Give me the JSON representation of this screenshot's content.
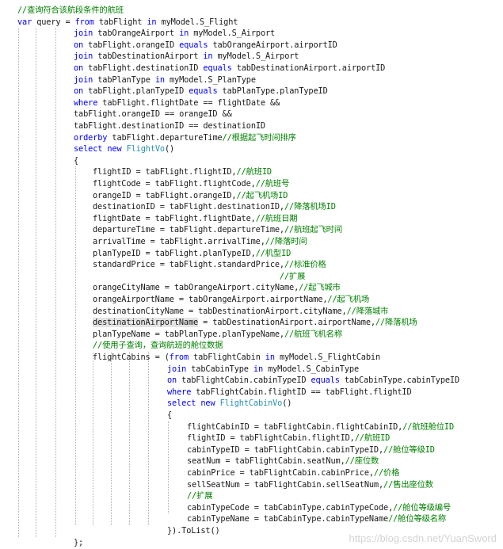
{
  "code_lines": [
    [
      {
        "t": "//查询符合该航段条件的航班",
        "c": "cm"
      }
    ],
    [
      {
        "t": "var",
        "c": "kw"
      },
      {
        "t": " query = "
      },
      {
        "t": "from",
        "c": "kw"
      },
      {
        "t": " tabFlight "
      },
      {
        "t": "in",
        "c": "kw"
      },
      {
        "t": " myModel.S_Flight"
      }
    ],
    [
      {
        "t": "join",
        "c": "kw"
      },
      {
        "t": " tabOrangeAirport "
      },
      {
        "t": "in",
        "c": "kw"
      },
      {
        "t": " myModel.S_Airport"
      }
    ],
    [
      {
        "t": "on",
        "c": "kw"
      },
      {
        "t": " tabFlight.orangeID "
      },
      {
        "t": "equals",
        "c": "kw"
      },
      {
        "t": " tabOrangeAirport.airportID"
      }
    ],
    [
      {
        "t": "join",
        "c": "kw"
      },
      {
        "t": " tabDestinationAirport "
      },
      {
        "t": "in",
        "c": "kw"
      },
      {
        "t": " myModel.S_Airport"
      }
    ],
    [
      {
        "t": "on",
        "c": "kw"
      },
      {
        "t": " tabFlight.destinationID "
      },
      {
        "t": "equals",
        "c": "kw"
      },
      {
        "t": " tabDestinationAirport.airportID"
      }
    ],
    [
      {
        "t": "join",
        "c": "kw"
      },
      {
        "t": " tabPlanType "
      },
      {
        "t": "in",
        "c": "kw"
      },
      {
        "t": " myModel.S_PlanType"
      }
    ],
    [
      {
        "t": "on",
        "c": "kw"
      },
      {
        "t": " tabFlight.planTypeID "
      },
      {
        "t": "equals",
        "c": "kw"
      },
      {
        "t": " tabPlanType.planTypeID"
      }
    ],
    [
      {
        "t": "where",
        "c": "kw"
      },
      {
        "t": " tabFlight.flightDate == flightDate &&"
      }
    ],
    [
      {
        "t": "tabFlight.orangeID == orangeID &&"
      }
    ],
    [
      {
        "t": "tabFlight.destinationID == destinationID"
      }
    ],
    [
      {
        "t": "orderby",
        "c": "kw"
      },
      {
        "t": " tabFlight.departureTime"
      },
      {
        "t": "//根据起飞时间排序",
        "c": "cm"
      }
    ],
    [
      {
        "t": "select",
        "c": "kw"
      },
      {
        "t": " "
      },
      {
        "t": "new",
        "c": "kw"
      },
      {
        "t": " "
      },
      {
        "t": "FlightVo",
        "c": "ty"
      },
      {
        "t": "()"
      }
    ],
    [
      {
        "t": "{"
      }
    ],
    [
      {
        "t": "flightID = tabFlight.flightID,"
      },
      {
        "t": "//航班ID",
        "c": "cm"
      }
    ],
    [
      {
        "t": "flightCode = tabFlight.flightCode,"
      },
      {
        "t": "//航班号",
        "c": "cm"
      }
    ],
    [
      {
        "t": "orangeID = tabFlight.orangeID,"
      },
      {
        "t": "//起飞机场ID",
        "c": "cm"
      }
    ],
    [
      {
        "t": "destinationID = tabFlight.destinationID,"
      },
      {
        "t": "//降落机场ID",
        "c": "cm"
      }
    ],
    [
      {
        "t": "flightDate = tabFlight.flightDate,"
      },
      {
        "t": "//航班日期",
        "c": "cm"
      }
    ],
    [
      {
        "t": "departureTime = tabFlight.departureTime,"
      },
      {
        "t": "//航班起飞时间",
        "c": "cm"
      }
    ],
    [
      {
        "t": "arrivalTime = tabFlight.arrivalTime,"
      },
      {
        "t": "//降落时间",
        "c": "cm"
      }
    ],
    [
      {
        "t": "planTypeID = tabFlight.planTypeID,"
      },
      {
        "t": "//机型ID",
        "c": "cm"
      }
    ],
    [
      {
        "t": "standardPrice = tabFlight.standardPrice,"
      },
      {
        "t": "//标准价格",
        "c": "cm"
      }
    ],
    [
      {
        "t": "                                       "
      },
      {
        "t": "//扩展",
        "c": "cm"
      }
    ],
    [
      {
        "t": "orangeCityName = tabOrangeAirport.cityName,"
      },
      {
        "t": "//起飞城市",
        "c": "cm"
      }
    ],
    [
      {
        "t": "orangeAirportName = tabOrangeAirport.airportName,"
      },
      {
        "t": "//起飞机场",
        "c": "cm"
      }
    ],
    [
      {
        "t": "destinationCityName = tabDestinationAirport.cityName,"
      },
      {
        "t": "//降落城市",
        "c": "cm"
      }
    ],
    [
      {
        "t": "destinationAirportName",
        "c": "hl"
      },
      {
        "t": " = tabDestinationAirport.airportName,"
      },
      {
        "t": "//降落机场",
        "c": "cm"
      }
    ],
    [
      {
        "t": "planTypeName = tabPlanType.planTypeName,"
      },
      {
        "t": "//航班飞机名称",
        "c": "cm"
      }
    ],
    [
      {
        "t": "//使用子查询，查询航班的舱位数据",
        "c": "cm"
      }
    ],
    [
      {
        "t": "flightCabins = ("
      },
      {
        "t": "from",
        "c": "kw"
      },
      {
        "t": " tabFlightCabin "
      },
      {
        "t": "in",
        "c": "kw"
      },
      {
        "t": " myModel.S_FlightCabin"
      }
    ],
    [
      {
        "t": "join",
        "c": "kw"
      },
      {
        "t": " tabCabinType "
      },
      {
        "t": "in",
        "c": "kw"
      },
      {
        "t": " myModel.S_CabinType"
      }
    ],
    [
      {
        "t": "on",
        "c": "kw"
      },
      {
        "t": " tabFlightCabin.cabinTypeID "
      },
      {
        "t": "equals",
        "c": "kw"
      },
      {
        "t": " tabCabinType.cabinTypeID"
      }
    ],
    [
      {
        "t": "where",
        "c": "kw"
      },
      {
        "t": " tabFlightCabin.flightID == tabFlight.flightID"
      }
    ],
    [
      {
        "t": "select",
        "c": "kw"
      },
      {
        "t": " "
      },
      {
        "t": "new",
        "c": "kw"
      },
      {
        "t": " "
      },
      {
        "t": "FlightCabinVo",
        "c": "ty"
      },
      {
        "t": "()"
      }
    ],
    [
      {
        "t": "{"
      }
    ],
    [
      {
        "t": "flightCabinID = tabFlightCabin.flightCabinID,"
      },
      {
        "t": "//航班舱位ID",
        "c": "cm"
      }
    ],
    [
      {
        "t": "flightID = tabFlightCabin.flightID,"
      },
      {
        "t": "//航班ID",
        "c": "cm"
      }
    ],
    [
      {
        "t": "cabinTypeID = tabFlightCabin.cabinTypeID,"
      },
      {
        "t": "//舱位等级ID",
        "c": "cm"
      }
    ],
    [
      {
        "t": "seatNum = tabFlightCabin.seatNum,"
      },
      {
        "t": "//座位数",
        "c": "cm"
      }
    ],
    [
      {
        "t": "cabinPrice = tabFlightCabin.cabinPrice,"
      },
      {
        "t": "//价格",
        "c": "cm"
      }
    ],
    [
      {
        "t": "sellSeatNum = tabFlightCabin.sellSeatNum,"
      },
      {
        "t": "//售出座位数",
        "c": "cm"
      }
    ],
    [
      {
        "t": "//扩展",
        "c": "cm"
      }
    ],
    [
      {
        "t": "cabinTypeCode = tabCabinType.cabinTypeCode,"
      },
      {
        "t": "//舱位等级编号",
        "c": "cm"
      }
    ],
    [
      {
        "t": "cabinTypeName = tabCabinType.cabinTypeName"
      },
      {
        "t": "//舱位等级名称",
        "c": "cm"
      }
    ],
    [
      {
        "t": "}).ToList()"
      }
    ],
    [
      {
        "t": "};"
      }
    ]
  ],
  "watermark": "https://blog.csdn.net/YuanSword",
  "colors": {
    "keyword": "#0000ff",
    "comment": "#008000",
    "type": "#2b91af",
    "text": "#1a1a1a",
    "selection_highlight": "#e4e4e4",
    "background": "#ffffff"
  }
}
